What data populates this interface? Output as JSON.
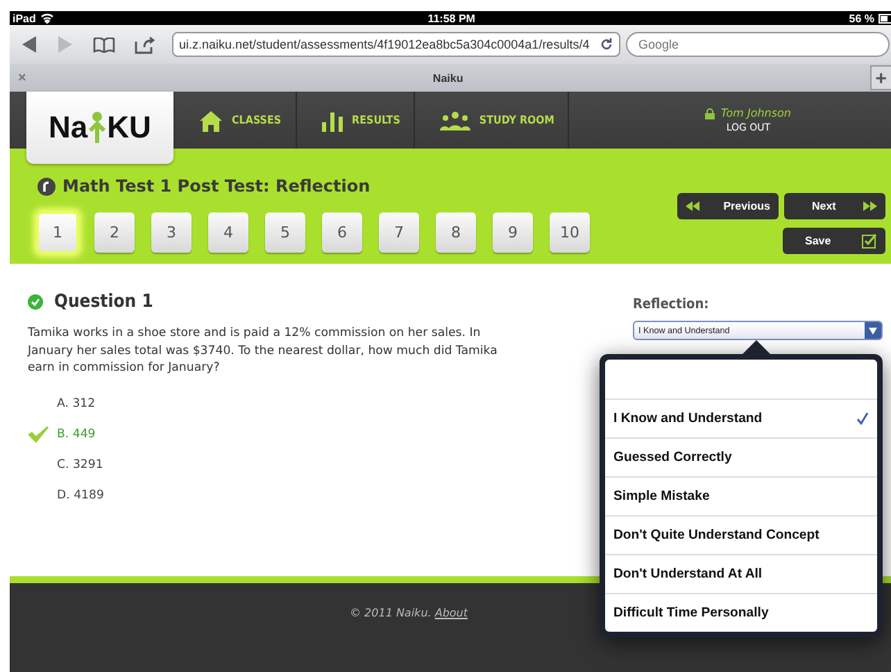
{
  "status_bar": {
    "device": "iPad",
    "time": "11:58 PM",
    "battery": "56 %"
  },
  "browser": {
    "url": "ui.z.naiku.net/student/assessments/4f19012ea8bc5a304c0004a1/results/4",
    "search_placeholder": "Google",
    "tab_title": "Naiku",
    "close": "×",
    "new_tab": "+"
  },
  "logo": {
    "left": "Na",
    "right": "KU"
  },
  "nav": [
    {
      "label": "CLASSES",
      "kind": "home"
    },
    {
      "label": "RESULTS",
      "kind": "bars"
    },
    {
      "label": "STUDY ROOM",
      "kind": "people"
    }
  ],
  "user": {
    "name": "Tom Johnson",
    "logout": "LOG OUT"
  },
  "test_title": "Math Test 1 Post Test: Reflection",
  "questions": [
    {
      "label": "1",
      "selected": true
    },
    {
      "label": "2",
      "selected": false
    },
    {
      "label": "3",
      "selected": false
    },
    {
      "label": "4",
      "selected": false
    },
    {
      "label": "5",
      "selected": false
    },
    {
      "label": "6",
      "selected": false
    },
    {
      "label": "7",
      "selected": false
    },
    {
      "label": "8",
      "selected": false
    },
    {
      "label": "9",
      "selected": false
    },
    {
      "label": "10",
      "selected": false
    }
  ],
  "buttons": {
    "previous": "Previous",
    "next": "Next",
    "save": "Save"
  },
  "question": {
    "title": "Question 1",
    "correct": true,
    "text": "Tamika works in a shoe store and is paid a 12% commission on her sales. In January her sales total was $3740. To the nearest dollar, how much did Tamika earn in commission for January?"
  },
  "choices": [
    {
      "text": "A. 312",
      "correct": false
    },
    {
      "text": "B. 449",
      "correct": true
    },
    {
      "text": "C. 3291",
      "correct": false
    },
    {
      "text": "D. 4189",
      "correct": false
    }
  ],
  "reflection": {
    "label": "Reflection:",
    "value": "I Know and Understand"
  },
  "options": [
    {
      "label": "I Know and Understand",
      "selected": true
    },
    {
      "label": "Guessed Correctly",
      "selected": false
    },
    {
      "label": "Simple Mistake",
      "selected": false
    },
    {
      "label": "Don't Quite Understand Concept",
      "selected": false
    },
    {
      "label": "Don't Understand At All",
      "selected": false
    },
    {
      "label": "Difficult Time Personally",
      "selected": false
    }
  ],
  "footer": {
    "text": "© 2011 Naiku.",
    "link": "About"
  }
}
